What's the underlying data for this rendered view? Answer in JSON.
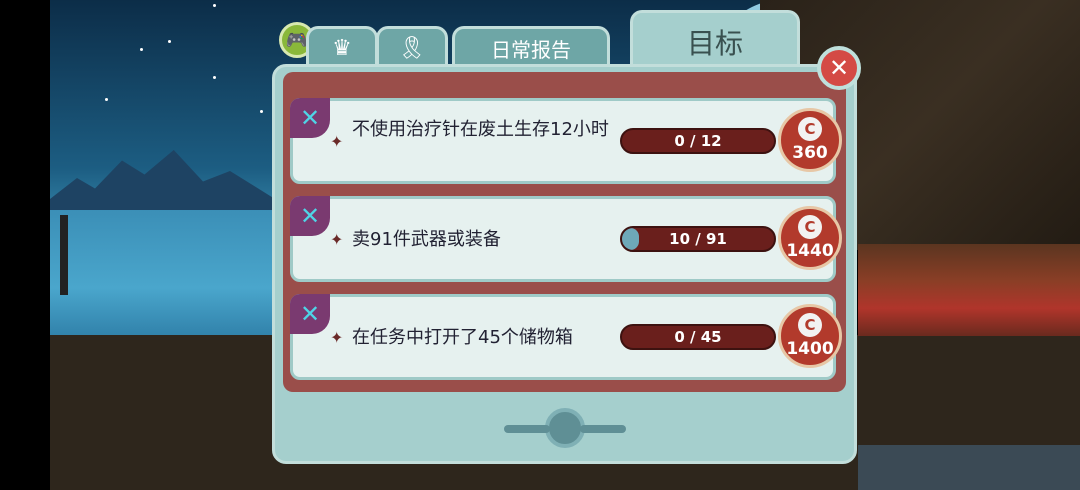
{
  "tabs": {
    "controller_icon": "gamepad-icon",
    "crown_icon": "crown-icon",
    "ribbon_icon": "ribbon-icon",
    "daily_label": "日常报告",
    "objectives_label": "目标"
  },
  "close_icon": "close-icon",
  "objectives": [
    {
      "text": "不使用治疗针在废土生存12小时",
      "progress": "0 / 12",
      "fraction": 0,
      "reward": "360"
    },
    {
      "text": "卖91件武器或装备",
      "progress": "10 / 91",
      "fraction": 0.11,
      "reward": "1440"
    },
    {
      "text": "在任务中打开了45个储物箱",
      "progress": "0 / 45",
      "fraction": 0,
      "reward": "1400"
    }
  ],
  "colors": {
    "panel": "#a5cfcd",
    "inner": "#9a4e4a",
    "cap": "#b23a2c",
    "bar": "#6a1f1c",
    "bar_fill": "#6ea8b8"
  }
}
